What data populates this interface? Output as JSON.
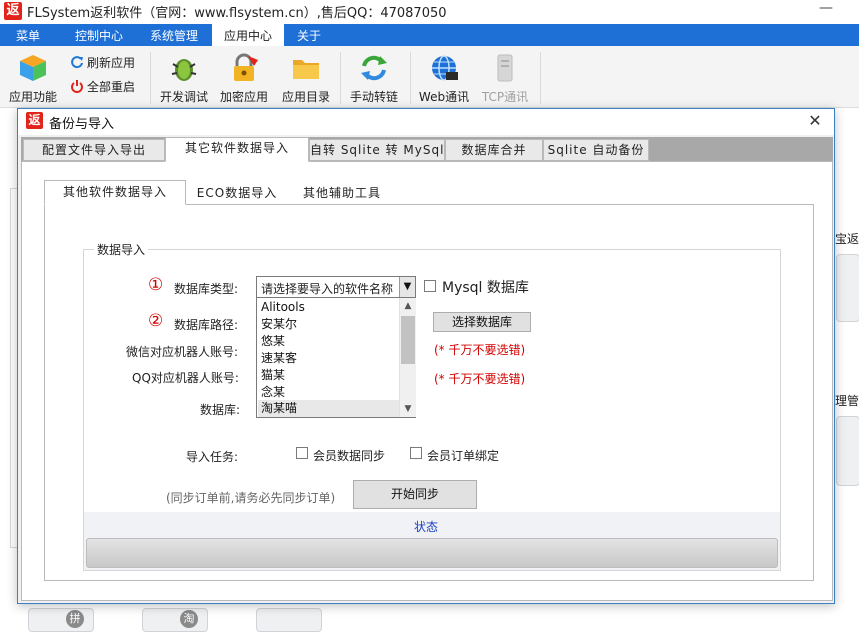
{
  "app": {
    "title": "FLSystem返利软件（官网：www.flsystem.cn）,售后QQ：47087050",
    "logo_char": "返",
    "minimize_glyph": "—"
  },
  "menubar": {
    "items": [
      "菜单",
      "控制中心",
      "系统管理",
      "应用中心",
      "关于"
    ],
    "active": "应用中心"
  },
  "ribbon": {
    "app_functions": "应用功能",
    "refresh_app": "刷新应用",
    "restart_all": "全部重启",
    "dev_debug": "开发调试",
    "encrypt_app": "加密应用",
    "app_directory": "应用目录",
    "manual_link": "手动转链",
    "web_comm": "Web通讯",
    "tcp_comm": "TCP通讯"
  },
  "background": {
    "right_label_1": "宝返",
    "right_label_2": "理管",
    "tile_char_1": "拼",
    "tile_char_2": "淘"
  },
  "dialog": {
    "title": "备份与导入",
    "logo_char": "返",
    "close_glyph": "✕",
    "tabs": [
      "配置文件导入导出",
      "其它软件数据导入",
      "自转 Sqlite 转 MySql",
      "数据库合并",
      "Sqlite 自动备份"
    ],
    "active_tab": "其它软件数据导入",
    "subtabs": [
      "其他软件数据导入",
      "ECO数据导入",
      "其他辅助工具"
    ],
    "active_subtab": "其他软件数据导入",
    "group_title": "数据导入",
    "circle_1": "①",
    "circle_2": "②",
    "db_type_label": "数据库类型:",
    "db_path_label": "数据库路径:",
    "wechat_label": "微信对应机器人账号:",
    "qq_label": "QQ对应机器人账号:",
    "database_label": "数据库:",
    "db_select_value": "请选择要导入的软件名称",
    "dropdown_items": [
      "Alitools",
      "安某尔",
      "悠某",
      "速某客",
      "猫某",
      "念某",
      "淘某喵"
    ],
    "mysql_checkbox_label": "Mysql 数据库",
    "mysql_checked": false,
    "choose_db_button": "选择数据库",
    "warn_1": "(* 千万不要选错)",
    "warn_2": "(* 千万不要选错)",
    "import_task_label": "导入任务:",
    "member_sync_label": "会员数据同步",
    "member_sync_checked": false,
    "order_bind_label": "会员订单绑定",
    "order_bind_checked": false,
    "sync_hint": "(同步订单前,请务必先同步订单)",
    "start_sync_button": "开始同步",
    "status_label": "状态",
    "progress": 0
  }
}
